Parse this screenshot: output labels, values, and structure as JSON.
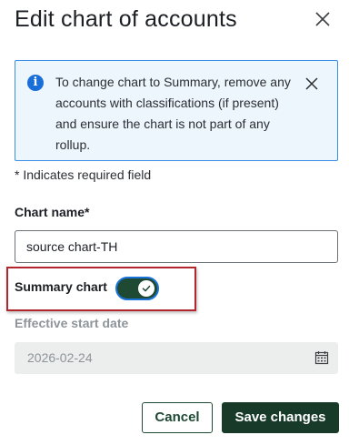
{
  "dialog": {
    "title": "Edit chart of accounts"
  },
  "banner": {
    "message": "To change chart to Summary, remove any accounts with classifications (if present) and ensure the chart is not part of any rollup."
  },
  "form": {
    "required_note": "* Indicates required field",
    "chart_name": {
      "label": "Chart name*",
      "value": "source chart-TH"
    },
    "summary_chart": {
      "label": "Summary chart",
      "checked": true
    },
    "effective_start_date": {
      "label": "Effective start date",
      "value": "2026-02-24",
      "disabled": true
    }
  },
  "actions": {
    "cancel_label": "Cancel",
    "save_label": "Save changes"
  },
  "colors": {
    "primary": "#173a29",
    "info_border": "#3a8ee6",
    "info_bg": "#edf5fd",
    "highlight": "#b3262e"
  },
  "icons": {
    "close": "close-icon",
    "info": "info-icon",
    "banner_close": "close-icon",
    "toggle_check": "check-icon",
    "calendar": "calendar-icon"
  }
}
